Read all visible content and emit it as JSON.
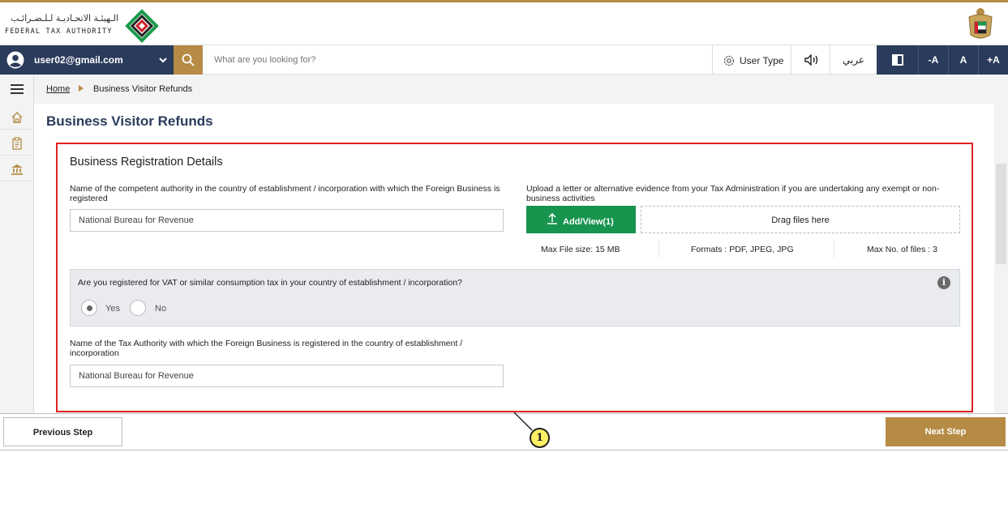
{
  "header": {
    "logo_arabic": "الـهيئـة الاتحـاديـة لـلـضـرائـب",
    "logo_english": "FEDERAL TAX AUTHORITY",
    "emblem_icon": "uae-emblem-icon"
  },
  "navbar": {
    "user_email": "user02@gmail.com",
    "search_placeholder": "What are you looking for?",
    "user_type_label": "User Type",
    "language_label": "عربي",
    "font_decrease": "-A",
    "font_reset": "A",
    "font_increase": "+A"
  },
  "breadcrumb": {
    "home": "Home",
    "current": "Business Visitor Refunds"
  },
  "page_title": "Business Visitor Refunds",
  "section": {
    "title": "Business Registration Details",
    "authority_label": "Name of the competent authority in the country of establishment / incorporation with which the Foreign Business is registered",
    "authority_value": "National Bureau for Revenue",
    "upload_label": "Upload a letter or alternative evidence from your Tax Administration if you are undertaking any exempt or non-business activities",
    "upload_button": "Add/View(1)",
    "dropzone_text": "Drag files here",
    "max_file_size": "Max File size: 15 MB",
    "formats": "Formats : PDF, JPEG, JPG",
    "max_files": "Max No. of files : 3",
    "vat_question": "Are you registered for VAT or similar consumption tax in your country of establishment / incorporation?",
    "vat_options": [
      "Yes",
      "No"
    ],
    "vat_selected": "Yes",
    "tax_authority_label": "Name of the Tax Authority with which the Foreign Business is registered in the country of establishment / incorporation",
    "tax_authority_value": "National Bureau for Revenue"
  },
  "footer": {
    "previous": "Previous Step",
    "next": "Next Step"
  },
  "annotation": {
    "callout_number": "1",
    "highlight_color": "#e02020"
  },
  "colors": {
    "navy": "#2a3b5c",
    "gold": "#b58b45",
    "green": "#17944e"
  }
}
